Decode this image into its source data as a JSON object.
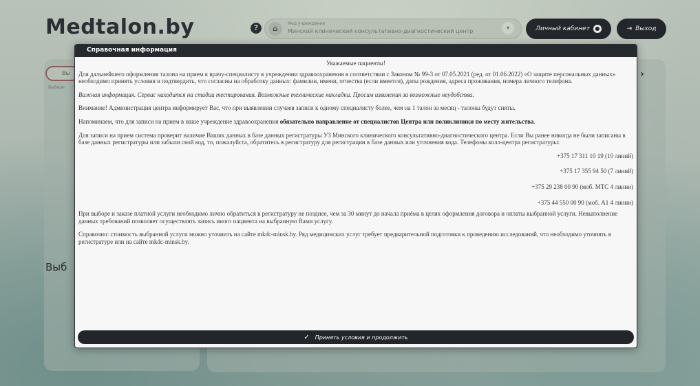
{
  "app": {
    "logo": "Medtalon.by",
    "institution_caption": "Мед учреждение",
    "institution_value": "Минский клинический консультативно-диагностический центр",
    "cabinet_label": "Личный кабинет",
    "logout_label": "Выход",
    "left_pill_fragment": "Вы",
    "left_caption_fragment": "Выбери",
    "choose_fragment": "Выб"
  },
  "modal": {
    "title": "Справочная информация",
    "greeting": "Уважаемые пациенты!",
    "para_consent": "Для дальнейшего оформления талона на прием к врачу-специалисту в учреждении здравоохранения в соответствии с Законом № 99-3 от 07.05.2021 (ред. от 01.06.2022) «О защите персональных данных» необходимо принять условия и подтвердить, что согласны на обработку данных: фамилии, имени, отчества (если имеется), даты рождения, адреса проживания, номера личного телефона.",
    "para_testing": "Важная информация. Сервис находится на стадии тестирования. Возможные технические накладки. Просим извинения за возможные неудобства.",
    "para_attention": "Внимание! Администрация центра информирует Вас, что при выявлении случаев записи к одному специалисту более, чем на 1 талон за месяц - талоны будут сняты.",
    "para_reminder_prefix": "Напоминаем, что для записи на прием в наше учреждение здравоохранения ",
    "para_reminder_bold": "обязательно направление от специалистов Центра или поликлиники по месту жительства",
    "para_reminder_suffix": ".",
    "para_registry": "Для записи на прием система проверит наличие Ваших данных в базе данных регистратуры УЗ Минского клинического консультативно-диагностического центра. Если Вы ранее никогда не были записаны в базе данных регистратуры или забыли свой код, то, пожалуйста, обратитесь в регистратуру для регистрации в базе данных или уточнения кода. Телефоны колл-центра регистратуры:",
    "phones": [
      "+375 17 311 10 19 (10 линий)",
      "+375 17 355 94 50 (7 линий)",
      "+375 29 238 00 90 (моб. МТС 4 линии)",
      "+375 44 550 00 90 (моб. А1 4 линии)"
    ],
    "para_paid": "При выборе и заказе платной услуги необходимо лично обратиться в регистратуру не позднее, чем за 30 минут до начала приёма в целях оформления договора и оплаты выбранной услуги. Невыполнение данных требований позволяет осуществлять запись иного пациента на выбранную Вами услугу.",
    "para_reference": "Справочно: стоимость выбранной услуги можно уточнить на сайте mkdc-minsk.by. Ряд медицинских услуг требует предварительной подготовки к проведению исследований, что необходимо уточнять в регистратуре или на сайте mkdc-minsk.by.",
    "accept_label": "Принять условия и продолжить"
  },
  "icons": {
    "help": "help-icon",
    "institution": "hospital-icon",
    "caret": "chevron-down-icon",
    "user": "user-icon",
    "logout": "logout-icon",
    "check": "check-icon"
  }
}
